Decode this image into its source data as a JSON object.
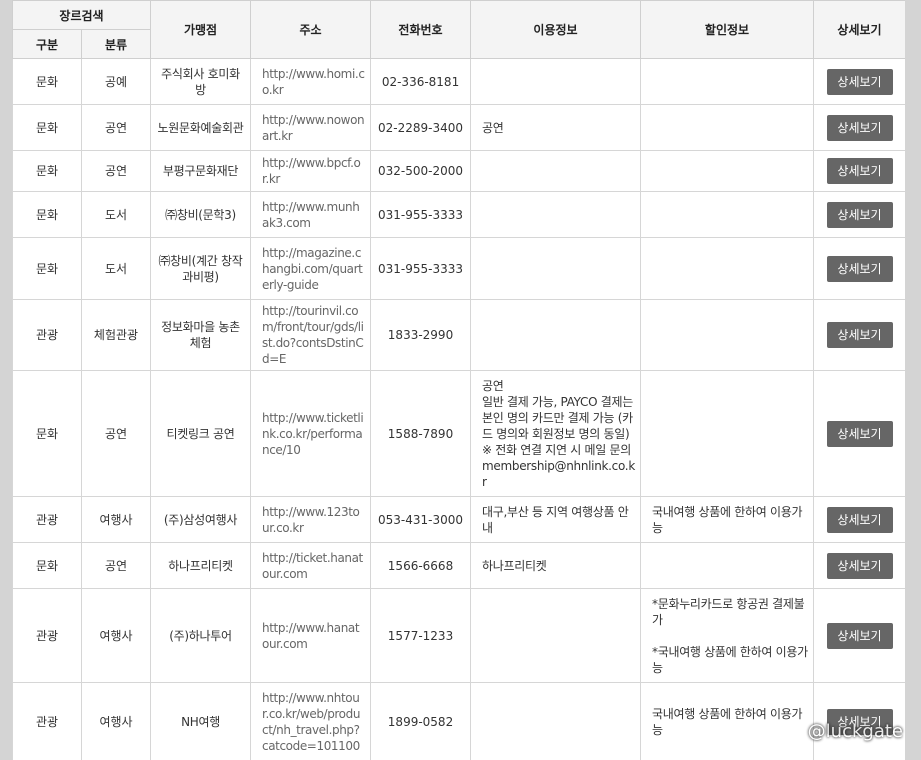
{
  "headers": {
    "genre_search": "장르검색",
    "category": "구분",
    "classification": "분류",
    "merchant": "가맹점",
    "address": "주소",
    "phone": "전화번호",
    "usage_info": "이용정보",
    "discount_info": "할인정보",
    "details": "상세보기"
  },
  "rows": [
    {
      "category": "문화",
      "type": "공예",
      "merchant": "주식회사 호미화방",
      "url": "http://www.homi.co.kr",
      "phone": "02-336-8181",
      "usage": "",
      "discount": "",
      "button": "상세보기"
    },
    {
      "category": "문화",
      "type": "공연",
      "merchant": "노원문화예술회관",
      "url": "http://www.nowonart.kr",
      "phone": "02-2289-3400",
      "usage": "공연",
      "discount": "",
      "button": "상세보기"
    },
    {
      "category": "문화",
      "type": "공연",
      "merchant": "부평구문화재단",
      "url": "http://www.bpcf.or.kr",
      "phone": "032-500-2000",
      "usage": "",
      "discount": "",
      "button": "상세보기"
    },
    {
      "category": "문화",
      "type": "도서",
      "merchant": "㈜창비(문학3)",
      "url": "http://www.munhak3.com",
      "phone": "031-955-3333",
      "usage": "",
      "discount": "",
      "button": "상세보기"
    },
    {
      "category": "문화",
      "type": "도서",
      "merchant": "㈜창비(계간 창작과비평)",
      "url": "http://magazine.changbi.com/quarterly-guide",
      "phone": "031-955-3333",
      "usage": "",
      "discount": "",
      "button": "상세보기"
    },
    {
      "category": "관광",
      "type": "체험관광",
      "merchant": "정보화마을 농촌체험",
      "url": "http://tourinvil.com/front/tour/gds/list.do?contsDstinCd=E",
      "phone": "1833-2990",
      "usage": "",
      "discount": "",
      "button": "상세보기"
    },
    {
      "category": "문화",
      "type": "공연",
      "merchant": "티켓링크 공연",
      "url": "http://www.ticketlink.co.kr/performance/10",
      "phone": "1588-7890",
      "usage": "공연\n일반 결제 가능, PAYCO 결제는 본인 명의 카드만 결제 가능 (카드 명의와 회원정보 명의 동일)\n※ 전화 연결 지연 시 메일 문의 membership@nhnlink.co.kr",
      "discount": "",
      "button": "상세보기"
    },
    {
      "category": "관광",
      "type": "여행사",
      "merchant": "(주)삼성여행사",
      "url": "http://www.123tour.co.kr",
      "phone": "053-431-3000",
      "usage": "대구,부산 등 지역 여행상품 안내",
      "discount": "국내여행 상품에 한하여 이용가능",
      "button": "상세보기"
    },
    {
      "category": "문화",
      "type": "공연",
      "merchant": "하나프리티켓",
      "url": "http://ticket.hanatour.com",
      "phone": "1566-6668",
      "usage": "하나프리티켓",
      "discount": "",
      "button": "상세보기"
    },
    {
      "category": "관광",
      "type": "여행사",
      "merchant": "(주)하나투어",
      "url": "http://www.hanatour.com",
      "phone": "1577-1233",
      "usage": "",
      "discount": "*문화누리카드로 항공권 결제불가\n\n*국내여행 상품에 한하여 이용가능",
      "button": "상세보기"
    },
    {
      "category": "관광",
      "type": "여행사",
      "merchant": "NH여행",
      "url": "http://www.nhtour.co.kr/web/product/nh_travel.php?catcode=101100",
      "phone": "1899-0582",
      "usage": "",
      "discount": "국내여행 상품에 한하여 이용가능",
      "button": "상세보기"
    }
  ],
  "watermark": "@luckgate"
}
